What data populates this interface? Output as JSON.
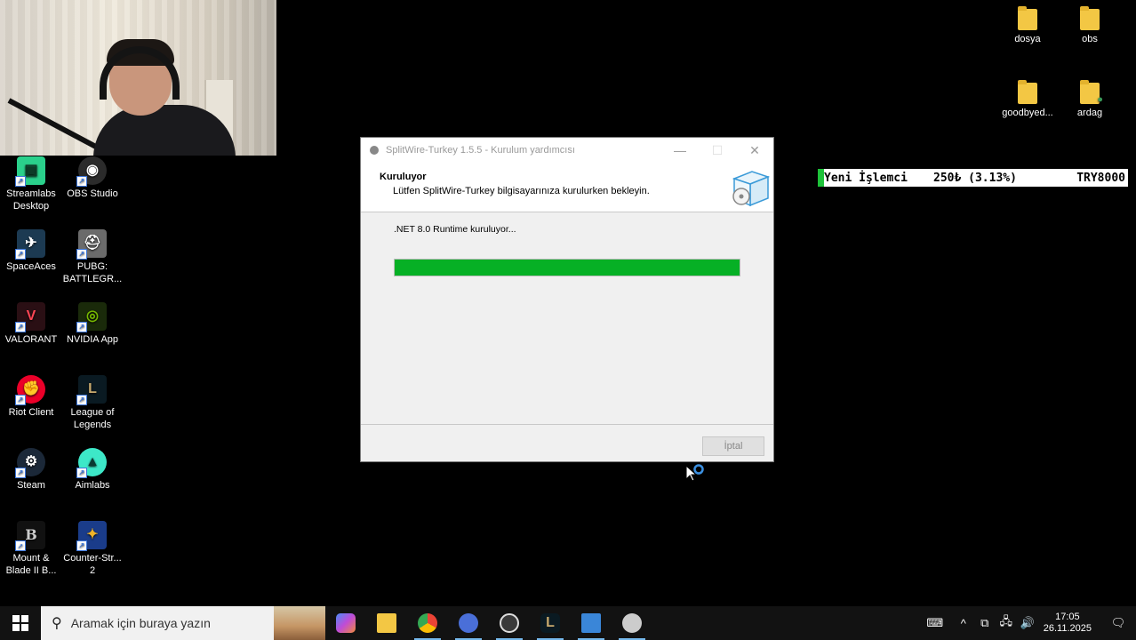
{
  "desktop": {
    "left_icons": [
      {
        "label": "Streamlabs Desktop",
        "icon": "streamlabs-icon",
        "color": "#2ad08b"
      },
      {
        "label": "OBS Studio",
        "icon": "obs-icon",
        "color": "#2b2b2b"
      },
      {
        "label": "SpaceAces",
        "icon": "spaceaces-icon",
        "color": "#1c3a52"
      },
      {
        "label": "PUBG: BATTLEGR...",
        "icon": "pubg-icon",
        "color": "#6b6b6b"
      },
      {
        "label": "VALORANT",
        "icon": "valorant-icon",
        "color": "#ff4655"
      },
      {
        "label": "NVIDIA App",
        "icon": "nvidia-icon",
        "color": "#76b900"
      },
      {
        "label": "Riot Client",
        "icon": "riot-icon",
        "color": "#eb0029"
      },
      {
        "label": "League of Legends",
        "icon": "league-icon",
        "color": "#c8aa6e"
      },
      {
        "label": "Steam",
        "icon": "steam-icon",
        "color": "#1b2838"
      },
      {
        "label": "Aimlabs",
        "icon": "aimlabs-icon",
        "color": "#3de8c8"
      },
      {
        "label": "Mount & Blade II B...",
        "icon": "bannerlord-icon",
        "color": "#2a2a2a"
      },
      {
        "label": "Counter-Str... 2",
        "icon": "cs2-icon",
        "color": "#1a3c8a"
      }
    ],
    "right_icons": [
      {
        "label": "dosya",
        "icon": "folder-icon"
      },
      {
        "label": "obs",
        "icon": "folder-icon"
      },
      {
        "label": "goodbyed...",
        "icon": "folder-icon"
      },
      {
        "label": "ardag",
        "icon": "user-folder-icon"
      }
    ]
  },
  "ticker": {
    "name": "Yeni İşlemci",
    "amount": "250₺ (3.13%)",
    "target": "TRY8000",
    "progress_fraction": 0.0313,
    "color": "#1ec23a"
  },
  "installer": {
    "title": "SplitWire-Turkey 1.5.5 - Kurulum yardımcısı",
    "heading": "Kuruluyor",
    "subheading": "Lütfen SplitWire-Turkey bilgisayarınıza kurulurken bekleyin.",
    "status": ".NET 8.0 Runtime kuruluyor...",
    "progress_percent": 100,
    "progress_color": "#06b025",
    "cancel_label": "İptal",
    "minimize": "—",
    "maximize": "☐",
    "close": "✕"
  },
  "taskbar": {
    "search_placeholder": "Aramak için buraya yazın",
    "apps": [
      {
        "icon": "copilot-icon",
        "color": "#c04bd6"
      },
      {
        "icon": "file-explorer-icon",
        "color": "#f3c744"
      },
      {
        "icon": "chrome-icon",
        "color": "#ea4335"
      },
      {
        "icon": "app-circle-icon",
        "color": "#4a6fd8"
      },
      {
        "icon": "obs-recording-icon",
        "color": "#3a3a3a"
      },
      {
        "icon": "league-icon",
        "color": "#c8aa6e"
      },
      {
        "icon": "window-app-icon",
        "color": "#3a86d8"
      },
      {
        "icon": "splitwire-icon",
        "color": "#cccccc"
      }
    ],
    "time": "17:05",
    "date": "26.11.2025"
  }
}
